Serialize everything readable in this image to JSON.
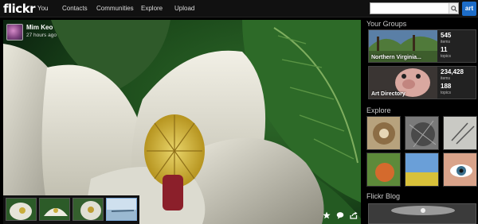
{
  "nav": {
    "logo": "flickr",
    "items": [
      "You",
      "Contacts",
      "Communities",
      "Explore",
      "Upload"
    ],
    "search_placeholder": "",
    "badge": "art"
  },
  "photo": {
    "owner_name": "Mim Keo",
    "posted": "27 hours ago"
  },
  "groups": {
    "title": "Your Groups",
    "items": [
      {
        "name": "Northern Virginia...",
        "count_a": "545",
        "label_a": "items",
        "count_b": "11",
        "label_b": "topics"
      },
      {
        "name": "Art Directory",
        "count_a": "234,428",
        "label_a": "items",
        "count_b": "188",
        "label_b": "topics"
      }
    ]
  },
  "explore": {
    "title": "Explore"
  },
  "blog": {
    "title": "Flickr Blog"
  },
  "colors": {
    "accent": "#1d6dc8",
    "nav_bg": "#111111"
  }
}
